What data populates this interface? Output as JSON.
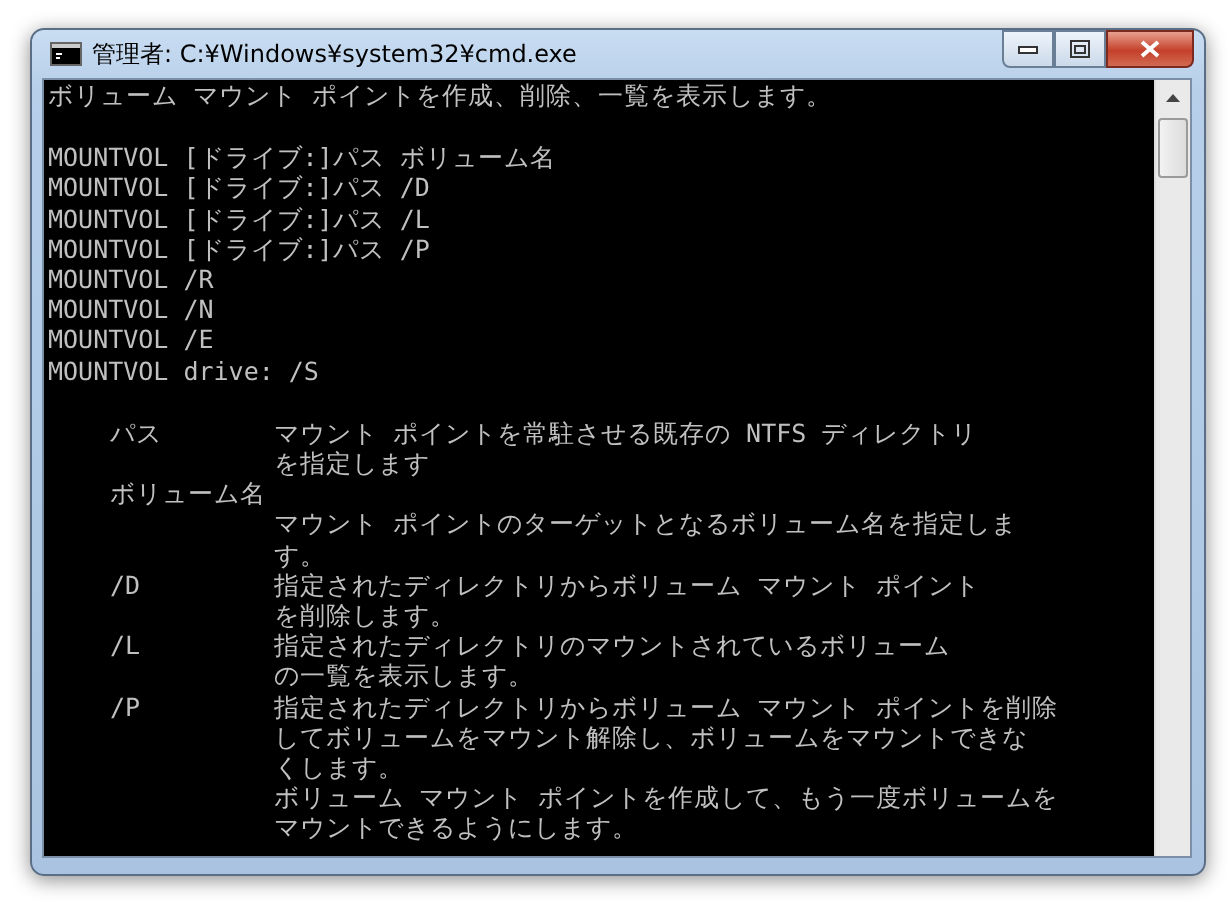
{
  "window": {
    "title": "管理者: C:¥Windows¥system32¥cmd.exe"
  },
  "console": {
    "header": "ボリューム マウント ポイントを作成、削除、一覧を表示します。",
    "usage": [
      "MOUNTVOL [ドライブ:]パス ボリューム名",
      "MOUNTVOL [ドライブ:]パス /D",
      "MOUNTVOL [ドライブ:]パス /L",
      "MOUNTVOL [ドライブ:]パス /P",
      "MOUNTVOL /R",
      "MOUNTVOL /N",
      "MOUNTVOL /E",
      "MOUNTVOL drive: /S"
    ],
    "parameters": [
      {
        "kind": "inline",
        "term": "パス",
        "lines": [
          "マウント ポイントを常駐させる既存の NTFS ディレクトリ",
          "を指定します"
        ]
      },
      {
        "kind": "stacked",
        "term": "ボリューム名",
        "lines": [
          "マウント ポイントのターゲットとなるボリューム名を指定しま",
          "す。"
        ]
      },
      {
        "kind": "inline",
        "term": "/D",
        "lines": [
          "指定されたディレクトリからボリューム マウント ポイント",
          "を削除します。"
        ]
      },
      {
        "kind": "inline",
        "term": "/L",
        "lines": [
          "指定されたディレクトリのマウントされているボリューム",
          "の一覧を表示します。"
        ]
      },
      {
        "kind": "inline",
        "term": "/P",
        "lines": [
          "指定されたディレクトリからボリューム マウント ポイントを削除",
          "してボリュームをマウント解除し、ボリュームをマウントできな",
          "くします。",
          "ボリューム マウント ポイントを作成して、もう一度ボリュームを",
          "マウントできるようにします。"
        ]
      }
    ]
  }
}
